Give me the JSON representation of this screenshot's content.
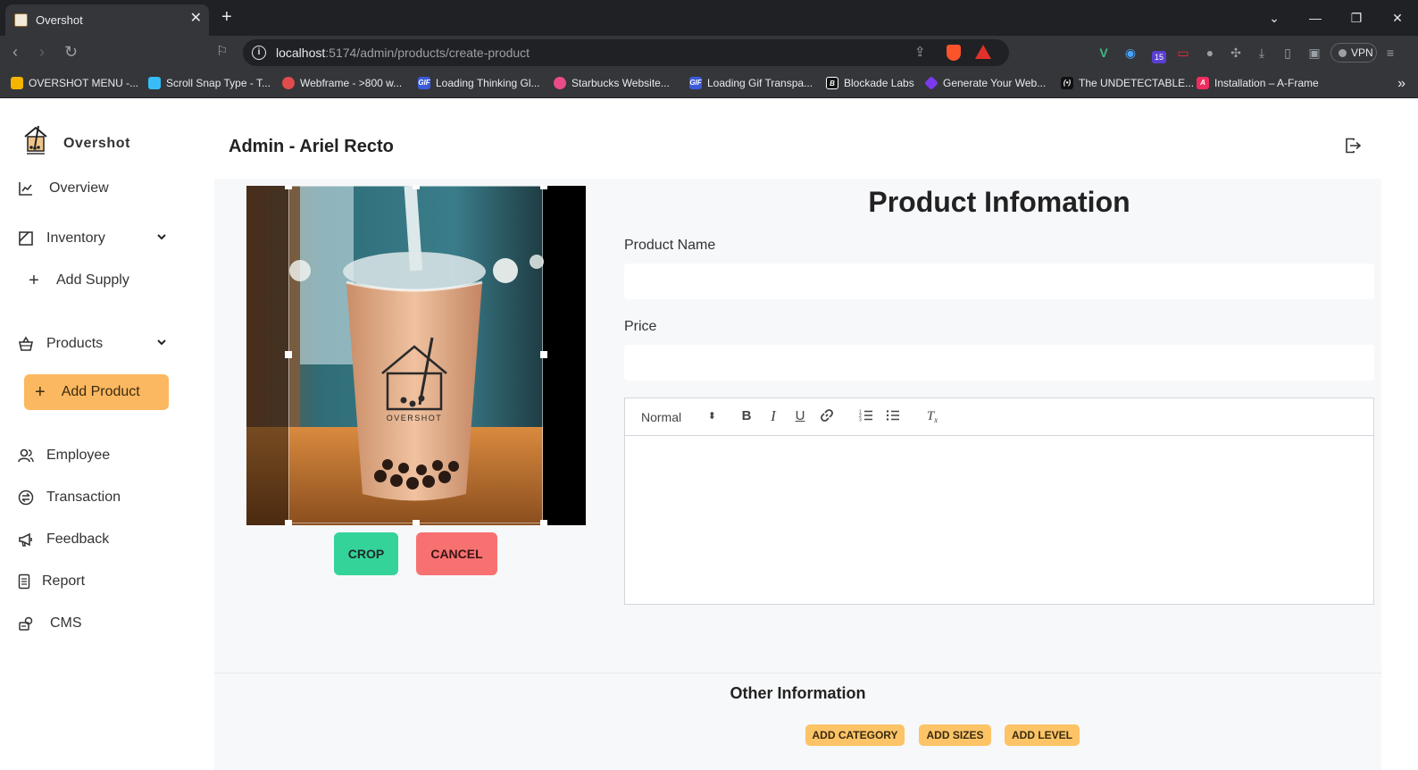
{
  "browser": {
    "tab_title": "Overshot",
    "url_host": "localhost",
    "url_path": ":5174/admin/products/create-product",
    "ext_badge": "15",
    "vpn_label": "VPN",
    "bookmarks": [
      {
        "label": "OVERSHOT MENU -...",
        "icon": "drive-icon",
        "color": "#f4b400"
      },
      {
        "label": "Scroll Snap Type - T...",
        "icon": "tailwind-icon",
        "color": "#38bdf8"
      },
      {
        "label": "Webframe - >800 w...",
        "icon": "webframe-icon",
        "color": "#e04b4b"
      },
      {
        "label": "Loading Thinking Gl...",
        "icon": "gif-icon",
        "color": "#3b5bdb"
      },
      {
        "label": "Starbucks Website...",
        "icon": "dribbble-icon",
        "color": "#ea4c89"
      },
      {
        "label": "Loading Gif Transpa...",
        "icon": "gif-icon",
        "color": "#3b5bdb"
      },
      {
        "label": "Blockade Labs",
        "icon": "blockade-icon",
        "color": "#111111"
      },
      {
        "label": "Generate Your Web...",
        "icon": "relume-icon",
        "color": "#7c3aed"
      },
      {
        "label": "The UNDETECTABLE...",
        "icon": "undetectable-icon",
        "color": "#111111"
      },
      {
        "label": "Installation – A-Frame",
        "icon": "aframe-icon",
        "color": "#ef2d5e"
      }
    ]
  },
  "sidebar": {
    "brand": "Overshot",
    "items": {
      "overview": "Overview",
      "inventory": "Inventory",
      "add_supply": "Add Supply",
      "products": "Products",
      "add_product": "Add Product",
      "employee": "Employee",
      "transaction": "Transaction",
      "feedback": "Feedback",
      "report": "Report",
      "cms": "CMS"
    }
  },
  "header": {
    "title": "Admin - Ariel Recto"
  },
  "cropper": {
    "crop_label": "CROP",
    "cancel_label": "CANCEL",
    "cup_brand": "OVERSHOT"
  },
  "form": {
    "title": "Product Infomation",
    "product_name_label": "Product Name",
    "product_name_value": "",
    "price_label": "Price",
    "price_value": "",
    "editor_format": "Normal"
  },
  "other": {
    "title": "Other Information",
    "add_category": "ADD CATEGORY",
    "add_sizes": "ADD SIZES",
    "add_level": "ADD LEVEL"
  },
  "colors": {
    "accent": "#fcb860",
    "crop": "#34d399",
    "cancel": "#f87171",
    "chip": "#fcc467"
  }
}
